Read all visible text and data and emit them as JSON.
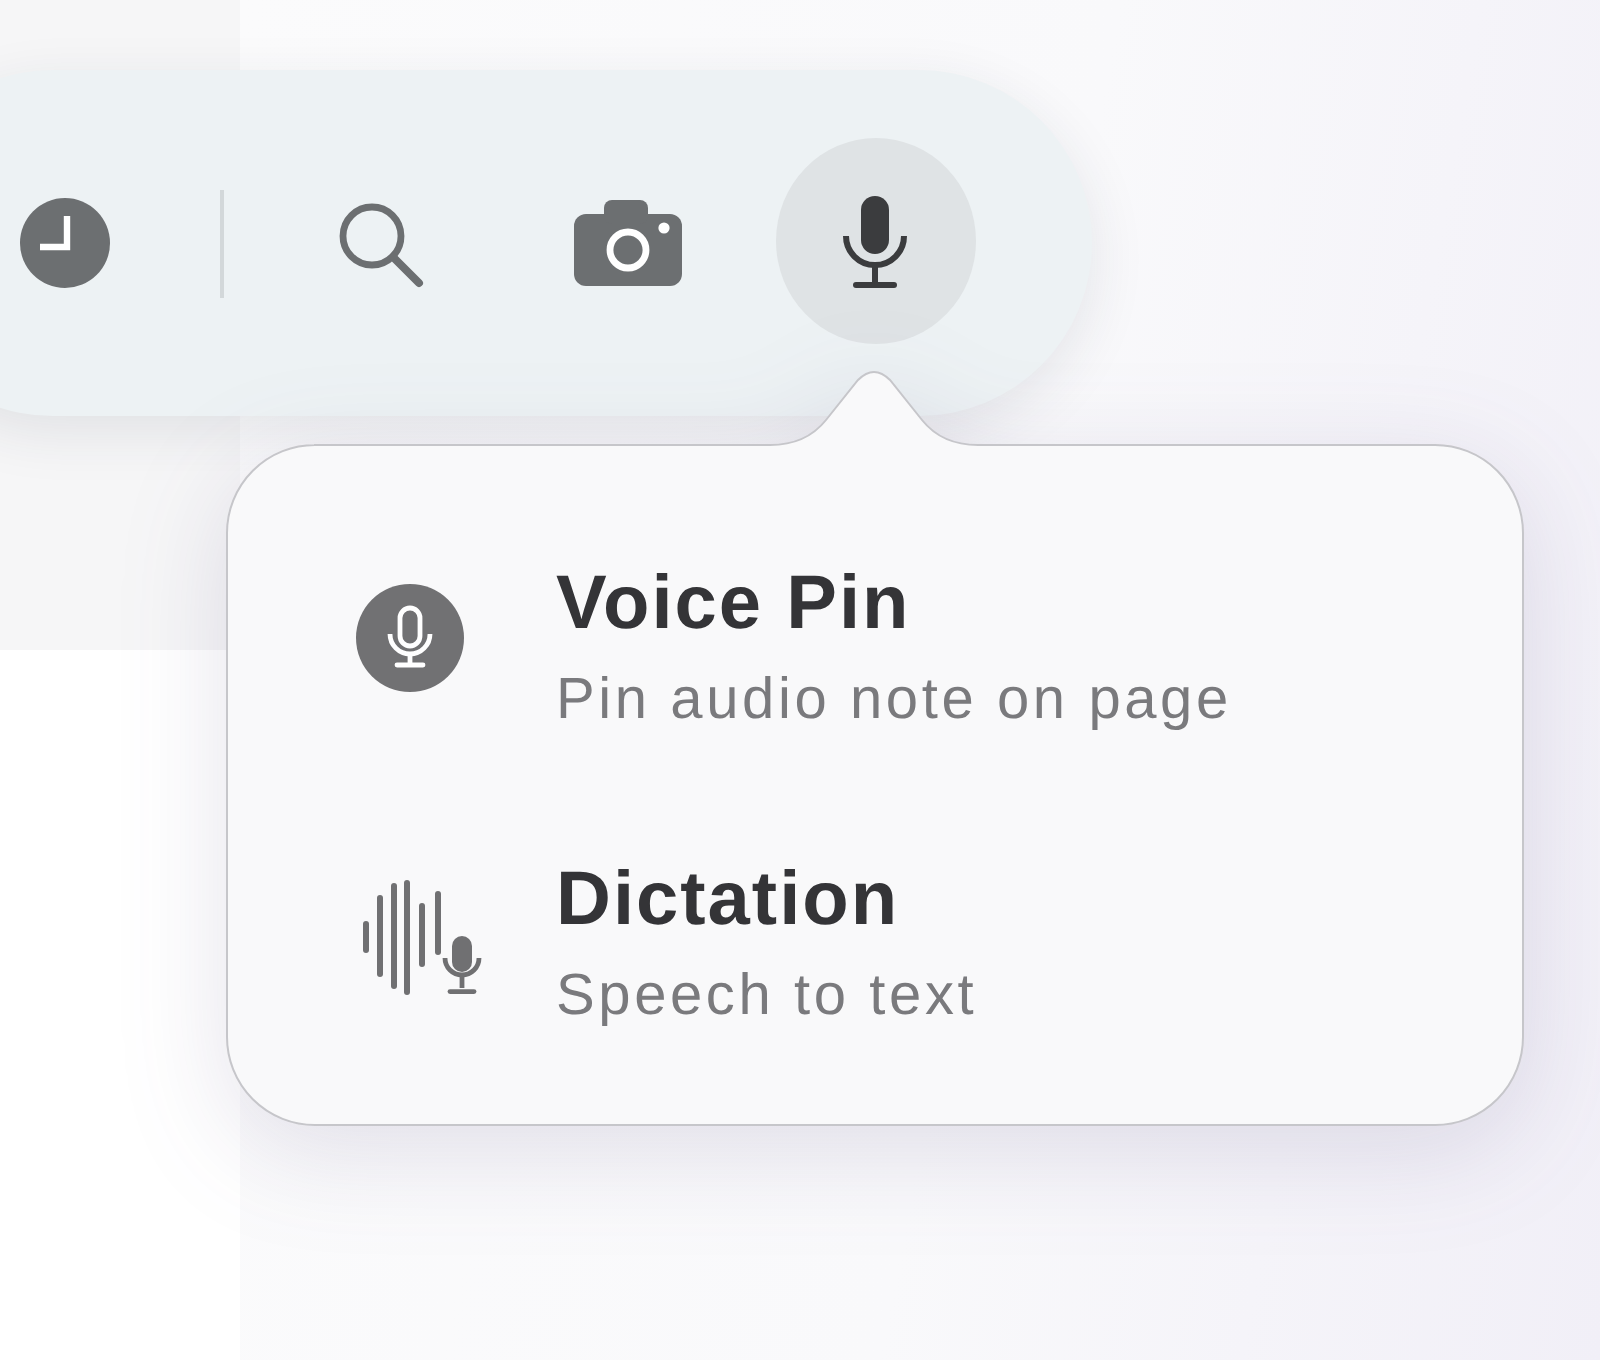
{
  "toolbar": {
    "buttons": [
      {
        "selected": false
      },
      {
        "selected": false
      },
      {
        "selected": false
      },
      {
        "selected": true
      }
    ]
  },
  "menu": {
    "items": [
      {
        "title": "Voice Pin",
        "subtitle": "Pin audio note on page"
      },
      {
        "title": "Dictation",
        "subtitle": "Speech to text"
      }
    ]
  }
}
